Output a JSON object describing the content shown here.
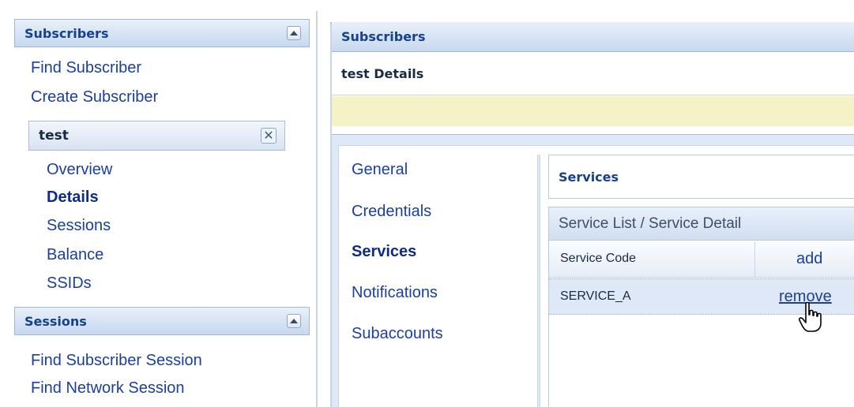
{
  "sidebar": {
    "subscribers_header": "Subscribers",
    "find_subscriber": "Find Subscriber",
    "create_subscriber": "Create Subscriber",
    "tab": {
      "title": "test",
      "close_glyph": "✕",
      "items": [
        "Overview",
        "Details",
        "Sessions",
        "Balance",
        "SSIDs"
      ],
      "active": "Details"
    },
    "sessions_header": "Sessions",
    "find_subscriber_session": "Find Subscriber Session",
    "find_network_session": "Find Network Session"
  },
  "main": {
    "header": "Subscribers",
    "details_title": "test Details",
    "side_tabs": [
      "General",
      "Credentials",
      "Services",
      "Notifications",
      "Subaccounts"
    ],
    "active_tab": "Services",
    "services_title": "Services",
    "list_title": "Service List / Service Detail",
    "columns": {
      "code": "Service Code",
      "action": "add"
    },
    "rows": [
      {
        "code": "SERVICE_A",
        "action": "remove"
      }
    ]
  },
  "colors": {
    "link": "#1a3f9e",
    "header_text": "#15428b",
    "notice_bg": "#f4f2c6",
    "row_bg": "#dfe8f6"
  },
  "icons": [
    "collapse-up-icon",
    "close-icon",
    "hand-cursor-icon"
  ]
}
